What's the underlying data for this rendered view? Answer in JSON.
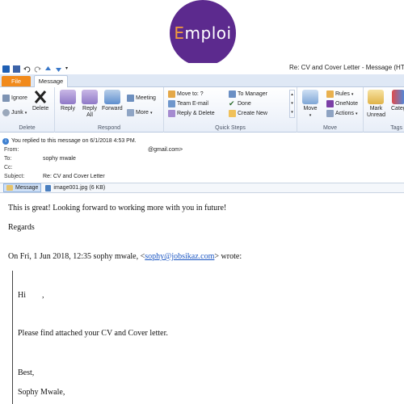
{
  "brand": {
    "logo_e": "E",
    "logo_rest": "mploi",
    "logo_color": "#5c2a8e",
    "logo_accent": "#f39c3c"
  },
  "window": {
    "title": "Re: CV and Cover Letter  -  Message (HTML)"
  },
  "tabs": {
    "file": "File",
    "message": "Message"
  },
  "ribbon": {
    "delete": {
      "ignore": "Ignore",
      "junk": "Junk",
      "delete": "Delete",
      "label": "Delete"
    },
    "respond": {
      "reply": "Reply",
      "reply_all": "Reply\nAll",
      "forward": "Forward",
      "meeting": "Meeting",
      "more": "More",
      "label": "Respond"
    },
    "quick_steps": {
      "move_to": "Move to: ?",
      "team_email": "Team E-mail",
      "reply_delete": "Reply & Delete",
      "to_manager": "To Manager",
      "done": "Done",
      "create_new": "Create New",
      "label": "Quick Steps"
    },
    "move": {
      "move": "Move",
      "rules": "Rules",
      "onenote": "OneNote",
      "actions": "Actions",
      "label": "Move"
    },
    "tags": {
      "mark_unread": "Mark\nUnread",
      "categorize": "Categ",
      "label": "Tags"
    }
  },
  "infobar": {
    "text": "You replied to this message on 6/1/2018 4:53 PM."
  },
  "headers": {
    "from_label": "From:",
    "from_value": "@gmail.com>",
    "to_label": "To:",
    "to_value": "sophy mwale",
    "cc_label": "Cc:",
    "cc_value": "",
    "subject_label": "Subject:",
    "subject_value": "Re: CV and Cover Letter"
  },
  "attachments": {
    "message_tab": "Message",
    "file": "image001.jpg (6 KB)"
  },
  "body": {
    "line1": "This is great! Looking forward to working more with you in future!",
    "line2": "Regards",
    "quote_prefix": "On Fri, 1 Jun 2018, 12:35 sophy mwale, <",
    "quote_email": "sophy@jobsikaz.com",
    "quote_suffix": "> wrote:",
    "greeting": "Hi        ,",
    "message": "Please find attached your CV and Cover letter.",
    "closing": "Best,",
    "signature": "Sophy Mwale,"
  }
}
